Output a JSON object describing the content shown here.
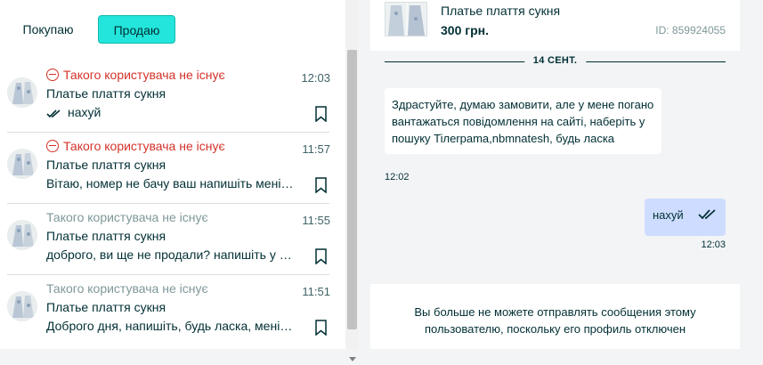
{
  "tabs": {
    "buy": "Покупаю",
    "sell": "Продаю"
  },
  "conversations": [
    {
      "name": "Такого користувача не існує",
      "title": "Платье плаття сукня",
      "last": "нахуй",
      "time": "12:03"
    },
    {
      "name": "Такого користувача не існує",
      "title": "Платье плаття сукня",
      "last": "Вітаю, номер не бачу ваш напишіть мені в Телеграмі",
      "time": "11:57"
    },
    {
      "name": "Такого користувача не існує",
      "title": "Платье плаття сукня",
      "last": "доброго, ви ще не продали? напишіть у телеграм",
      "time": "11:55"
    },
    {
      "name": "Такого користувача не існує",
      "title": "Платье плаття сукня",
      "last": "Доброго дня, напишіть, будь ласка, мені в телеграм",
      "time": "11:51"
    }
  ],
  "ad": {
    "title": "Платье плаття сукня",
    "price": "300 грн.",
    "id": "ID: 859924055"
  },
  "chat": {
    "date": "14 СЕНТ.",
    "incoming_text": "Здрастуйте, думаю замовити, але у мене погано вантажаться повідомлення на сайті, наберіть у пошуку Tiлerpama,nbmnatesh, будь ласка",
    "incoming_time": "12:02",
    "outgoing_text": "нахуй",
    "outgoing_time": "12:03"
  },
  "blocked_notice": "Вы больше не можете отправлять сообщения этому пользователю, поскольку его профиль отключен",
  "colors": {
    "accent": "#23e5db",
    "error": "#d3322a",
    "outgoing_bubble": "#ceddff",
    "text": "#002f34"
  }
}
